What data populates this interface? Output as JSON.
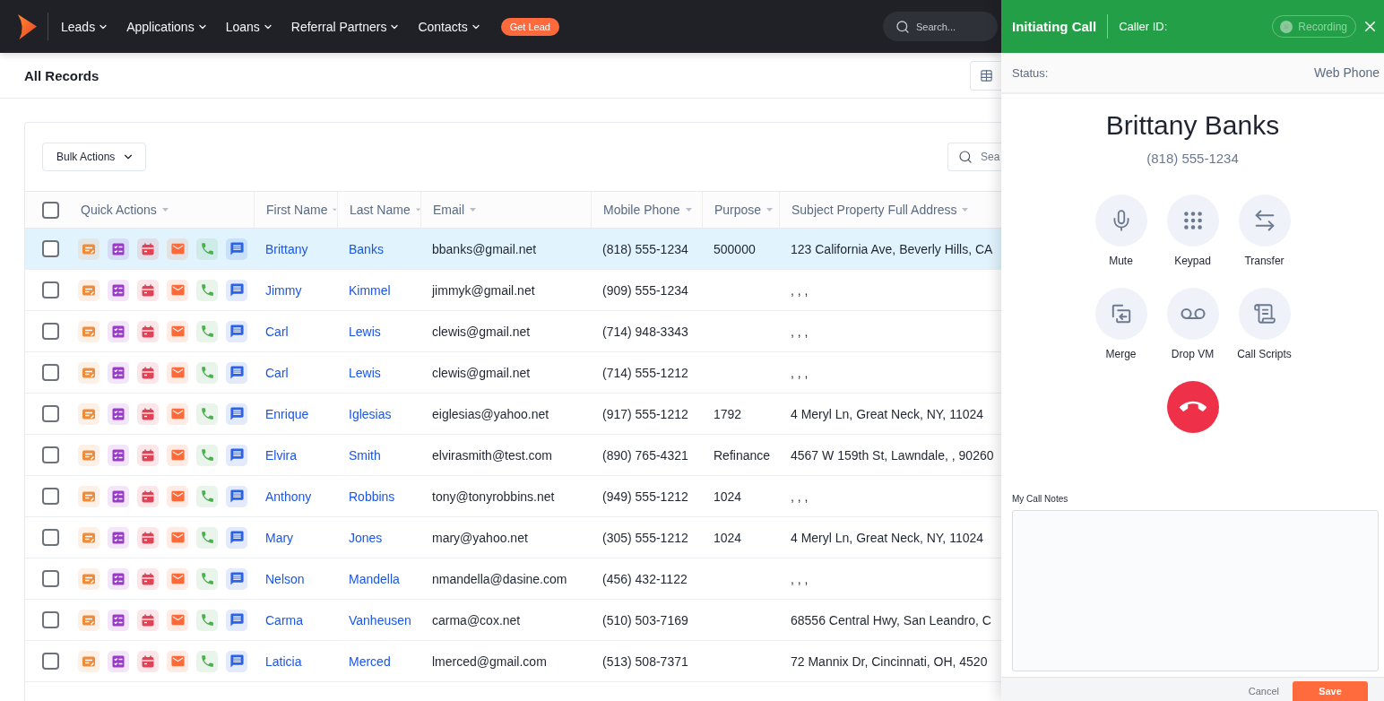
{
  "nav": {
    "items": [
      {
        "label": "Leads"
      },
      {
        "label": "Applications"
      },
      {
        "label": "Loans"
      },
      {
        "label": "Referral Partners"
      },
      {
        "label": "Contacts"
      }
    ],
    "cta": "Get Lead",
    "search": {
      "placeholder": "Search..."
    }
  },
  "page": {
    "title": "All Records"
  },
  "toolbar": {
    "bulk_actions": "Bulk Actions",
    "search": {
      "placeholder": "Sea"
    }
  },
  "table": {
    "header_checkbox": {
      "checked": false
    },
    "columns": [
      {
        "label": "Quick Actions"
      },
      {
        "label": "First Name"
      },
      {
        "label": "Last Name"
      },
      {
        "label": "Email"
      },
      {
        "label": "Mobile Phone"
      },
      {
        "label": "Purpose"
      },
      {
        "label": "Subject Property Full Address"
      }
    ],
    "rows": [
      {
        "selected": true,
        "checked": false,
        "first_name": "Brittany",
        "last_name": "Banks",
        "email": "bbanks@gmail.net",
        "mobile_phone": "(818) 555-1234",
        "purpose": "500000",
        "address": "123 California Ave, Beverly Hills, CA"
      },
      {
        "selected": false,
        "checked": false,
        "first_name": "Jimmy",
        "last_name": "Kimmel",
        "email": "jimmyk@gmail.net",
        "mobile_phone": "(909) 555-1234",
        "address": ", , ,"
      },
      {
        "selected": false,
        "checked": false,
        "first_name": "Carl",
        "last_name": "Lewis",
        "email": "clewis@gmail.net",
        "mobile_phone": "(714) 948-3343",
        "address": ", , ,"
      },
      {
        "selected": false,
        "checked": false,
        "first_name": "Carl",
        "last_name": "Lewis",
        "email": "clewis@gmail.net",
        "mobile_phone": "(714) 555-1212",
        "address": ", , ,"
      },
      {
        "selected": false,
        "checked": false,
        "first_name": "Enrique",
        "last_name": "Iglesias",
        "email": "eiglesias@yahoo.net",
        "mobile_phone": "(917) 555-1212",
        "purpose": "1792",
        "address": "4 Meryl Ln, Great Neck, NY, 11024"
      },
      {
        "selected": false,
        "checked": false,
        "first_name": "Elvira",
        "last_name": "Smith",
        "email": "elvirasmith@test.com",
        "mobile_phone": "(890) 765-4321",
        "purpose": "Refinance",
        "address": "4567 W 159th St, Lawndale, , 90260"
      },
      {
        "selected": false,
        "checked": false,
        "first_name": "Anthony",
        "last_name": "Robbins",
        "email": "tony@tonyrobbins.net",
        "mobile_phone": "(949) 555-1212",
        "purpose": "1024",
        "address": ", , ,"
      },
      {
        "selected": false,
        "checked": false,
        "first_name": "Mary",
        "last_name": "Jones",
        "email": "mary@yahoo.net",
        "mobile_phone": "(305) 555-1212",
        "purpose": "1024",
        "address": "4 Meryl Ln, Great Neck, NY, 11024"
      },
      {
        "selected": false,
        "checked": false,
        "first_name": "Nelson",
        "last_name": "Mandella",
        "email": "nmandella@dasine.com",
        "mobile_phone": "(456) 432-1122",
        "address": ", , ,"
      },
      {
        "selected": false,
        "checked": false,
        "first_name": "Carma",
        "last_name": "Vanheusen",
        "email": "carma@cox.net",
        "mobile_phone": "(510) 503-7169",
        "address": "68556 Central Hwy, San Leandro, C"
      },
      {
        "selected": false,
        "checked": false,
        "first_name": "Laticia",
        "last_name": "Merced",
        "email": "lmerced@gmail.com",
        "mobile_phone": "(513) 508-7371",
        "address": "72 Mannix Dr, Cincinnati, OH, 4520"
      }
    ]
  },
  "call_panel": {
    "title": "Initiating Call",
    "caller_id_label": "Caller ID:",
    "recording": {
      "label": "Recording",
      "disabled": true
    },
    "status_label": "Status:",
    "phone_type": "Web Phone",
    "contact_name": "Brittany Banks",
    "contact_phone": "(818) 555-1234",
    "actions": [
      {
        "kind": "mute",
        "label": "Mute"
      },
      {
        "kind": "keypad",
        "label": "Keypad"
      },
      {
        "kind": "transfer",
        "label": "Transfer"
      },
      {
        "kind": "merge",
        "label": "Merge"
      },
      {
        "kind": "voicemail",
        "label": "Drop VM"
      },
      {
        "kind": "scripts",
        "label": "Call Scripts"
      }
    ],
    "notes": {
      "label": "My Call Notes"
    },
    "cancel": "Cancel",
    "save": "Save"
  }
}
